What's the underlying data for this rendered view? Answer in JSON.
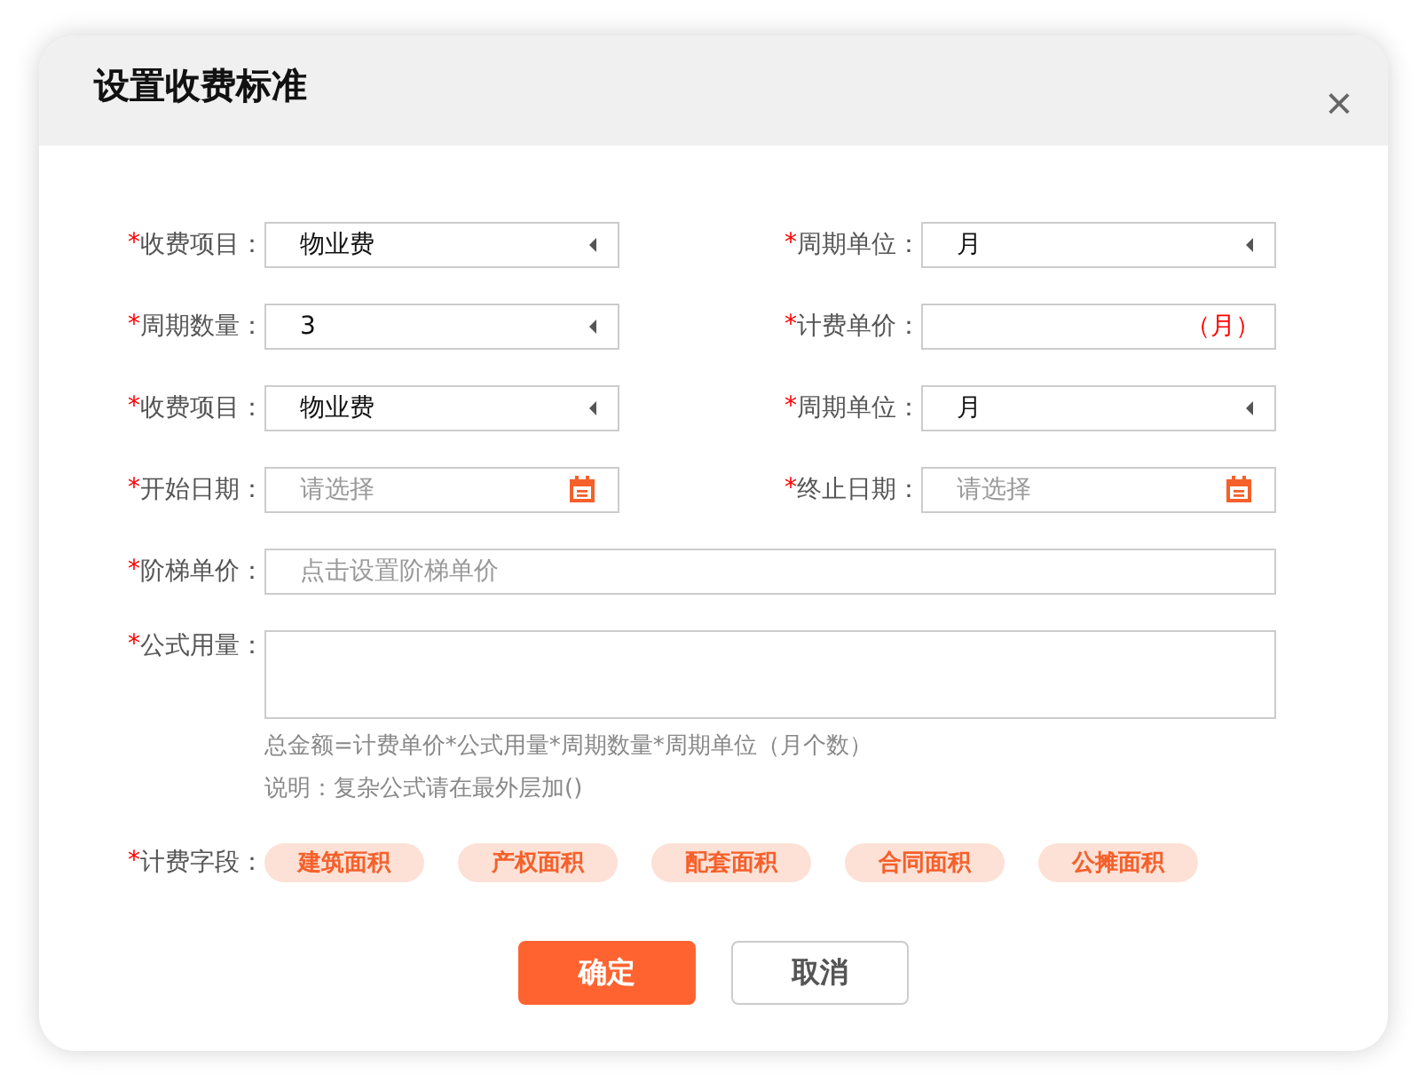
{
  "dialog": {
    "title": "设置收费标准",
    "close": "×"
  },
  "rows": [
    {
      "fields": [
        {
          "kind": "select",
          "mark": "*",
          "label": "收费项目：",
          "value": "物业费"
        },
        {
          "kind": "select",
          "mark": "*",
          "label": "周期单位：",
          "value": "月"
        }
      ]
    },
    {
      "fields": [
        {
          "kind": "select",
          "mark": "*",
          "label": "周期数量：",
          "value": "3"
        },
        {
          "kind": "unit",
          "mark": "*",
          "label": "计费单价：",
          "suffix": "（月）"
        }
      ]
    },
    {
      "fields": [
        {
          "kind": "select",
          "mark": "*",
          "label": "收费项目：",
          "value": "物业费"
        },
        {
          "kind": "select",
          "mark": "*",
          "label": "周期单位：",
          "value": "月"
        }
      ]
    },
    {
      "fields": [
        {
          "kind": "date",
          "mark": "*",
          "label": "开始日期：",
          "placeholder": "请选择"
        },
        {
          "kind": "date",
          "mark": "*",
          "label": "终止日期：",
          "placeholder": "请选择"
        }
      ]
    },
    {
      "fields": [
        {
          "kind": "wide",
          "mark": "*",
          "label": "阶梯单价：",
          "placeholder": "点击设置阶梯单价"
        }
      ]
    }
  ],
  "formula": {
    "mark": "*",
    "label": "公式用量：",
    "hints": [
      "总金额=计费单价*公式用量*周期数量*周期单位（月个数）",
      "说明：复杂公式请在最外层加()"
    ]
  },
  "billing_fields": {
    "mark": "*",
    "label": "计费字段：",
    "tags": [
      "建筑面积",
      "产权面积",
      "配套面积",
      "合同面积",
      "公摊面积"
    ]
  },
  "buttons": [
    {
      "kind": "primary",
      "label": "确定"
    },
    {
      "kind": "secondary",
      "label": "取消"
    }
  ]
}
